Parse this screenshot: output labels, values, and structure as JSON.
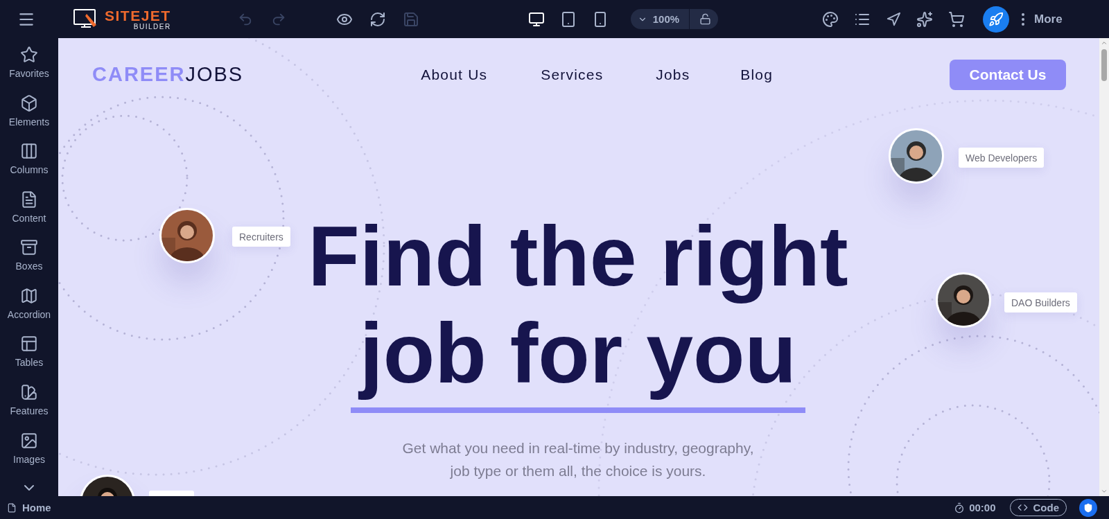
{
  "topbar": {
    "brand": "SITEJET",
    "brand_sub": "BUILDER",
    "history": [
      {
        "kind": "undo",
        "disabled": true
      },
      {
        "kind": "redo",
        "disabled": true
      }
    ],
    "actions": [
      {
        "kind": "preview",
        "disabled": false
      },
      {
        "kind": "refresh",
        "disabled": false
      },
      {
        "kind": "save",
        "disabled": true
      }
    ],
    "devices": [
      {
        "kind": "desktop",
        "selected": true
      },
      {
        "kind": "tablet",
        "selected": false
      },
      {
        "kind": "phone",
        "selected": false
      }
    ],
    "zoom": "100%",
    "more": "More"
  },
  "sidebar": {
    "items": [
      {
        "label": "Favorites"
      },
      {
        "label": "Elements"
      },
      {
        "label": "Columns"
      },
      {
        "label": "Content"
      },
      {
        "label": "Boxes"
      },
      {
        "label": "Accordion"
      },
      {
        "label": "Tables"
      },
      {
        "label": "Features"
      },
      {
        "label": "Images"
      }
    ]
  },
  "site": {
    "logo_accent": "CAREER",
    "logo_rest": "JOBS",
    "nav": [
      "About Us",
      "Services",
      "Jobs",
      "Blog"
    ],
    "cta": "Contact Us",
    "headline": [
      "Find the right",
      "job for you"
    ],
    "subtitle": "Get what you need in real-time by industry, geography, job type or them all, the choice is yours.",
    "avatars": [
      {
        "label": "Recruiters"
      },
      {
        "label": "Web Developers"
      },
      {
        "label": "DAO Builders"
      },
      {
        "kind": "cut"
      }
    ]
  },
  "status_bar": {
    "page": "Home",
    "timer": "00:00",
    "code": "Code"
  }
}
